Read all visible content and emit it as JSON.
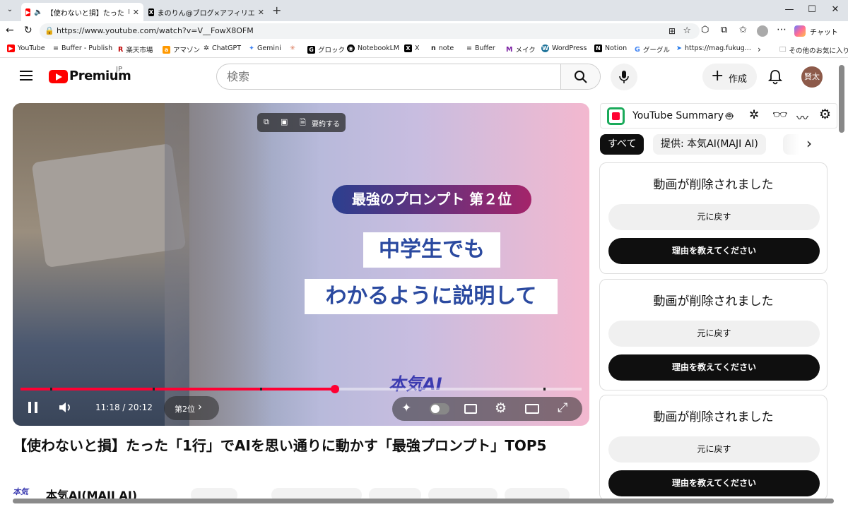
{
  "tabs": [
    {
      "title": "【使わないと損】たった「1行」でAI…",
      "active": true
    },
    {
      "title": "まのりん@ブログ×アフィリエイトで収益…",
      "active": false
    }
  ],
  "address": {
    "url": "https://www.youtube.com/watch?v=V__FowX8OFM",
    "profile_label": "チャット"
  },
  "bookmarks": [
    {
      "label": "YouTube",
      "color": "#ff0000",
      "glyph": "▶"
    },
    {
      "label": "Buffer - Publish",
      "color": "#222222",
      "glyph": "≡"
    },
    {
      "label": "楽天市場",
      "color": "#bf0000",
      "glyph": "R"
    },
    {
      "label": "アマゾン",
      "color": "#ff9900",
      "glyph": "a"
    },
    {
      "label": "ChatGPT",
      "color": "#555555",
      "glyph": "✲"
    },
    {
      "label": "Gemini",
      "color": "#4285f4",
      "glyph": "✦"
    },
    {
      "label": "",
      "color": "#d97757",
      "glyph": "✳"
    },
    {
      "label": "グロック",
      "color": "#000000",
      "glyph": "G"
    },
    {
      "label": "NotebookLM",
      "color": "#000000",
      "glyph": "◉"
    },
    {
      "label": "X",
      "color": "#000000",
      "glyph": "X"
    },
    {
      "label": "note",
      "color": "#ffffff",
      "glyph": "n"
    },
    {
      "label": "Buffer",
      "color": "#222222",
      "glyph": "≡"
    },
    {
      "label": "メイク",
      "color": "#7a1fa2",
      "glyph": "M"
    },
    {
      "label": "WordPress",
      "color": "#21759b",
      "glyph": "W"
    },
    {
      "label": "Notion",
      "color": "#000000",
      "glyph": "N"
    },
    {
      "label": "グーグル",
      "color": "#4285f4",
      "glyph": "G"
    },
    {
      "label": "https://mag.fukug...",
      "color": "#1a73e8",
      "glyph": "➤"
    }
  ],
  "bookmarks_other": "その他のお気に入り",
  "youtube": {
    "logo_text": "Premium",
    "region": "JP",
    "search_placeholder": "検索",
    "create_label": "作成",
    "avatar_text": "賢太"
  },
  "video": {
    "overlay_summary_label": "要約する",
    "rank_banner": "最強のプロンプト 第２位",
    "caption_line1": "中学生でも",
    "caption_line2": "わかるように説明して",
    "brand_logo": "本気AI",
    "time": "11:18 / 20:12",
    "chapter": "第2位",
    "progress": 0.56
  },
  "title": "【使わないと損】たった「1行」でAIを思い通りに動かす「最強プロンプト」TOP5",
  "channel": {
    "name": "本気AI(MAJI AI)"
  },
  "extension": {
    "name": "YouTube Summary"
  },
  "chips": [
    {
      "label": "すべて",
      "active": true
    },
    {
      "label": "提供: 本気AI(MAJI AI)",
      "active": false
    }
  ],
  "cards": [
    {
      "title": "動画が削除されました",
      "undo": "元に戻す",
      "reason": "理由を教えてください"
    },
    {
      "title": "動画が削除されました",
      "undo": "元に戻す",
      "reason": "理由を教えてください"
    },
    {
      "title": "動画が削除されました",
      "undo": "元に戻す",
      "reason": "理由を教えてください"
    }
  ]
}
